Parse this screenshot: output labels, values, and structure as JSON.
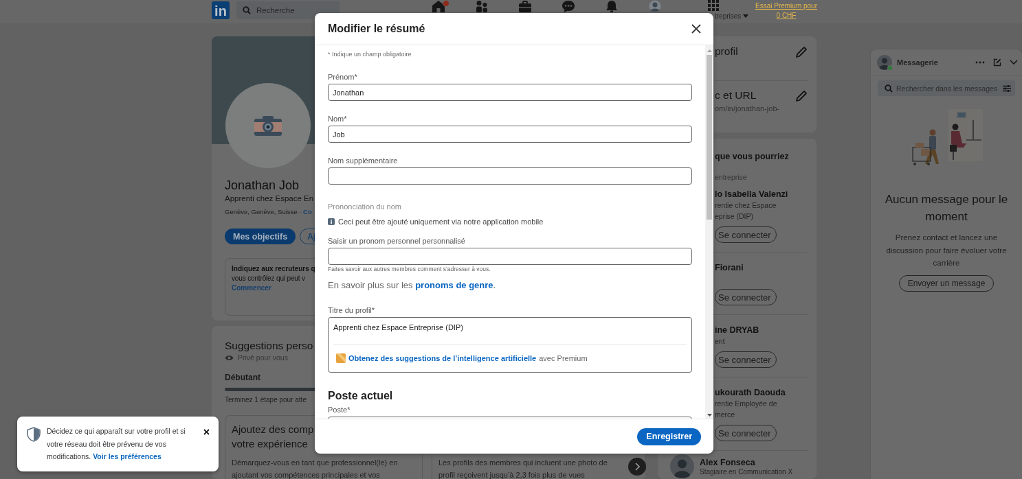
{
  "nav": {
    "logo": "in",
    "search_placeholder": "Recherche",
    "items": [
      {
        "kind": "home",
        "badge": true
      },
      {
        "kind": "network",
        "badge": false
      },
      {
        "kind": "jobs",
        "badge": false
      },
      {
        "kind": "messaging",
        "badge": false
      },
      {
        "kind": "notifications",
        "badge": false
      },
      {
        "kind": "me",
        "badge": false
      }
    ],
    "business_label": "treprises",
    "premium_link": "Essai Premium pour 0 CHF"
  },
  "profile": {
    "name": "Jonathan Job",
    "headline": "Apprenti chez Espace En",
    "location": "Genève, Genève, Suisse ·",
    "location_link": "Co",
    "buttons": [
      {
        "label": "Mes objectifs",
        "kind": "primary"
      },
      {
        "label": "Aj",
        "kind": "outline"
      }
    ],
    "notice": {
      "title": "Indiquez aux recruteurs q",
      "text": "vous contrôlez qui peut v",
      "link": "Commencer"
    }
  },
  "suggestions": {
    "title": "Suggestions perso",
    "privacy": "Privé pour vous",
    "stage": "Débutant",
    "status": "Terminez 1 étape pour atte",
    "cards": [
      {
        "title_lines": [
          "Ajoutez des comp",
          "votre expérience"
        ],
        "text_lines": [
          "Démarquez-vous en tant que professionnel(le) en",
          "ajoutant vos compétences principales et vos"
        ]
      },
      {
        "text_lines": [
          "Les profils des membres qui incluent une photo de",
          "profil reçoivent jusqu’à 2,3 fois plus de vues"
        ]
      }
    ]
  },
  "profile_settings": [
    {
      "title": "profil"
    },
    {
      "title": "c et URL",
      "text": "om/in/jonathan-job-"
    }
  ],
  "people": {
    "title": "que vous pourriez",
    "subtitle": "entreprise",
    "items": [
      {
        "name": "lo Isabella Valenzi",
        "avatar": false,
        "lines": [
          "rentie chez Espace",
          "eprise (DIP)"
        ],
        "button": "Se connecter"
      },
      {
        "name": "Fiorani",
        "avatar": false,
        "button": "Se connecter"
      },
      {
        "name": "ine DRYAB",
        "avatar": false,
        "lines": [
          "ent"
        ],
        "button": "Se connecter"
      },
      {
        "name": "ukourath Daouda",
        "avatar": false,
        "lines": [
          "rentie Employée de",
          "merce"
        ],
        "button": "Se connecter"
      },
      {
        "name": "Alex Fonseca",
        "avatar": true,
        "lines": [
          "Stagiaire en Communication X"
        ]
      }
    ]
  },
  "messaging": {
    "title": "Messagerie",
    "online": true,
    "search_placeholder": "Rechercher dans les messages",
    "empty_title": "Aucun message pour le moment",
    "empty_text": "Prenez contact et lancez une discussion pour faire évoluer votre carrière",
    "button": "Envoyer un message"
  },
  "modal": {
    "title": "Modifier le résumé",
    "required_note": "* Indique un champ obligatoire",
    "items": [
      {
        "kind": "input",
        "label": "Prénom*",
        "value": "Jonathan"
      },
      {
        "kind": "input",
        "label": "Nom*",
        "value": "Job"
      },
      {
        "kind": "input",
        "label": "Nom supplémentaire"
      },
      {
        "kind": "section_label",
        "text": "Prononciation du nom"
      },
      {
        "kind": "info",
        "text": "Ceci peut être ajouté uniquement via notre application mobile"
      },
      {
        "kind": "input",
        "label": "Saisir un pronom personnel personnalisé",
        "helper": "Faites savoir aux autres membres comment s’adresser à vous."
      },
      {
        "kind": "learn_more",
        "text": "En savoir plus sur les",
        "link": "pronoms de genre",
        "end": "."
      },
      {
        "kind": "textarea",
        "label": "Titre du profil*",
        "value": "Apprenti chez Espace Entreprise (DIP)",
        "ai_link": "Obtenez des suggestions de l’intelligence artificielle",
        "ai_note": "avec Premium"
      },
      {
        "kind": "heading",
        "text": "Poste actuel"
      },
      {
        "kind": "input",
        "label": "Poste*"
      }
    ],
    "save_button": "Enregistrer"
  },
  "toast": {
    "text": "Décidez ce qui apparaît sur votre profil et si votre réseau doit être prévenu de vos modifications.",
    "link": "Voir les préférences"
  }
}
